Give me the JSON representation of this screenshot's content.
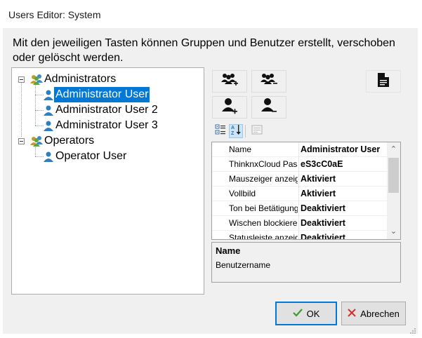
{
  "window": {
    "title": "Users Editor: System"
  },
  "instructions": "Mit den jeweiligen Tasten können Gruppen und Benutzer erstellt, verschoben oder gelöscht werden.",
  "tree": {
    "groups": [
      {
        "label": "Administrators",
        "icon": "group-icon",
        "users": [
          {
            "label": "Administrator User",
            "selected": true
          },
          {
            "label": "Administrator User 2"
          },
          {
            "label": "Administrator User 3"
          }
        ]
      },
      {
        "label": "Operators",
        "icon": "group-icon",
        "users": [
          {
            "label": "Operator User"
          }
        ]
      }
    ]
  },
  "toolbar": {
    "add_group": "add-group-icon",
    "remove_group": "remove-group-icon",
    "add_user": "add-user-icon",
    "remove_user": "remove-user-icon",
    "document": "document-icon",
    "categorized": "categorized-icon",
    "sort_az": "sort-alphabetical-icon",
    "property_pages": "property-pages-icon"
  },
  "properties": [
    {
      "name": "Name",
      "value": "Administrator User"
    },
    {
      "name": "ThinknxCloud Passwort",
      "value": "eS3cC0aE"
    },
    {
      "name": "Mauszeiger anzeigen",
      "value": "Aktiviert"
    },
    {
      "name": "Vollbild",
      "value": "Aktiviert"
    },
    {
      "name": "Ton bei Betätigung",
      "value": "Deaktiviert"
    },
    {
      "name": "Wischen blockieren",
      "value": "Deaktiviert"
    },
    {
      "name": "Statusleiste anzeigen",
      "value": "Deaktiviert"
    }
  ],
  "description": {
    "title": "Name",
    "text": "Benutzername"
  },
  "buttons": {
    "ok": "OK",
    "cancel": "Abrechen"
  },
  "colors": {
    "selection": "#0078d7",
    "ok_check": "#3c9c2c",
    "cancel_x": "#d03030"
  }
}
